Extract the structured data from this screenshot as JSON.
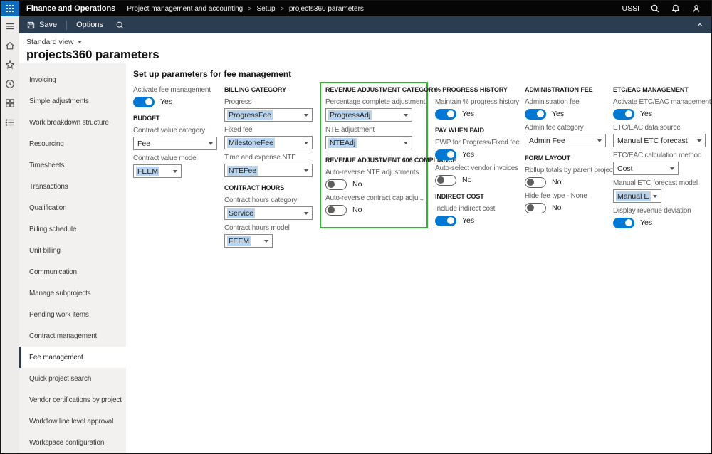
{
  "colors": {
    "accent": "#0078d4",
    "highlight_box": "#2db52d",
    "value_selection": "#b8d4ee"
  },
  "topbar": {
    "app_title": "Finance and Operations",
    "breadcrumb": [
      "Project management and accounting",
      "Setup",
      "projects360 parameters"
    ],
    "breadcrumb_separator": ">",
    "company": "USSI"
  },
  "actionbar": {
    "save": "Save",
    "options": "Options"
  },
  "page": {
    "view": "Standard view",
    "title": "projects360 parameters",
    "form_title": "Set up parameters for fee management"
  },
  "sidebar": {
    "selected": "Fee management",
    "items": [
      "Invoicing",
      "Simple adjustments",
      "Work breakdown structure",
      "Resourcing",
      "Timesheets",
      "Transactions",
      "Qualification",
      "Billing schedule",
      "Unit billing",
      "Communication",
      "Manage subprojects",
      "Pending work items",
      "Contract management",
      "Fee management",
      "Quick project search",
      "Vendor certifications by project",
      "Workflow line level approval",
      "Workspace configuration"
    ]
  },
  "form": {
    "columns": [
      {
        "groups": [
          {
            "header": "",
            "fields": [
              {
                "kind": "toggle",
                "label": "Activate fee management",
                "value": "Yes"
              }
            ]
          },
          {
            "header": "BUDGET",
            "fields": [
              {
                "kind": "combo",
                "label": "Contract value category",
                "value": "Fee"
              },
              {
                "kind": "combo",
                "label": "Contract value model",
                "value": "FEEM",
                "highlight": true,
                "size": "s"
              }
            ]
          }
        ]
      },
      {
        "groups": [
          {
            "header": "BILLING CATEGORY",
            "fields": [
              {
                "kind": "combo",
                "label": "Progress",
                "value": "ProgressFee",
                "highlight": true
              },
              {
                "kind": "combo",
                "label": "Fixed fee",
                "value": "MilestoneFee",
                "highlight": true
              },
              {
                "kind": "combo",
                "label": "Time and expense NTE",
                "value": "NTEFee",
                "highlight": true
              }
            ]
          },
          {
            "header": "CONTRACT HOURS",
            "fields": [
              {
                "kind": "combo",
                "label": "Contract hours category",
                "value": "Service",
                "highlight": true
              },
              {
                "kind": "combo",
                "label": "Contract hours model",
                "value": "FEEM",
                "highlight": true,
                "size": "s"
              }
            ]
          }
        ]
      },
      {
        "boxed": true,
        "groups": [
          {
            "header": "REVENUE ADJUSTMENT CATEGORY",
            "fields": [
              {
                "kind": "combo",
                "label": "Percentage complete adjustment",
                "value": "ProgressAdj",
                "highlight": true
              },
              {
                "kind": "combo",
                "label": "NTE adjustment",
                "value": "NTEAdj",
                "highlight": true
              }
            ]
          },
          {
            "header": "REVENUE ADJUSTMENT 606 COMPLIANCE",
            "fields": [
              {
                "kind": "toggle",
                "label": "Auto-reverse NTE adjustments",
                "value": "No"
              },
              {
                "kind": "toggle",
                "label": "Auto-reverse contract cap adju...",
                "value": "No"
              }
            ]
          }
        ]
      },
      {
        "groups": [
          {
            "header": "% PROGRESS HISTORY",
            "fields": [
              {
                "kind": "toggle",
                "label": "Maintain % progress history",
                "value": "Yes"
              }
            ]
          },
          {
            "header": "PAY WHEN PAID",
            "fields": [
              {
                "kind": "toggle",
                "label": "PWP for Progress/Fixed fee",
                "value": "Yes"
              },
              {
                "kind": "toggle",
                "label": "Auto-select vendor invoices",
                "value": "No"
              }
            ]
          },
          {
            "header": "INDIRECT COST",
            "fields": [
              {
                "kind": "toggle",
                "label": "Include indirect cost",
                "value": "Yes"
              }
            ]
          }
        ]
      },
      {
        "groups": [
          {
            "header": "ADMINISTRATION FEE",
            "fields": [
              {
                "kind": "toggle",
                "label": "Administration fee",
                "value": "Yes"
              },
              {
                "kind": "combo",
                "label": "Admin fee category",
                "value": "Admin Fee"
              }
            ]
          },
          {
            "header": "FORM LAYOUT",
            "fields": [
              {
                "kind": "toggle",
                "label": "Rollup totals by parent project",
                "value": "No"
              },
              {
                "kind": "toggle",
                "label": "Hide fee type - None",
                "value": "No"
              }
            ]
          }
        ]
      },
      {
        "groups": [
          {
            "header": "ETC/EAC MANAGEMENT",
            "fields": [
              {
                "kind": "toggle",
                "label": "Activate ETC/EAC management",
                "value": "Yes"
              },
              {
                "kind": "combo",
                "label": "ETC/EAC data source",
                "value": "Manual ETC forecast"
              },
              {
                "kind": "combo",
                "label": "ETC/EAC calculation method",
                "value": "Cost",
                "size": "m"
              },
              {
                "kind": "combo",
                "label": "Manual ETC forecast model",
                "value": "Manual ETC",
                "highlight": true,
                "size": "s"
              },
              {
                "kind": "toggle",
                "label": "Display revenue deviation",
                "value": "Yes"
              }
            ]
          }
        ]
      }
    ]
  }
}
